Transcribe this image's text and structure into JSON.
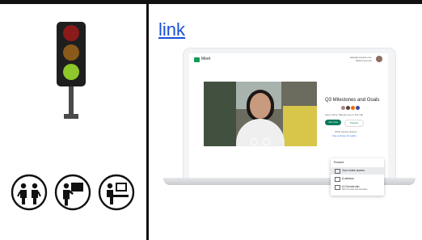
{
  "link": {
    "text": "link"
  },
  "meet": {
    "app_name": "Meet",
    "account": {
      "email": "katie@example.com",
      "switch": "Switch account"
    },
    "meeting_title": "Q3 Milestones and Goals",
    "in_call": "Lana, Chris, Maurice are in this call",
    "join_label": "Join now",
    "present_label": "Present",
    "other_options": "Other joining options",
    "phone_option": "Use a phone for audio",
    "present_menu": {
      "title": "Present",
      "items": [
        {
          "label": "Your entire screen",
          "sub": ""
        },
        {
          "label": "A window",
          "sub": ""
        },
        {
          "label": "A Chrome tab",
          "sub": "Best for video and animation"
        }
      ]
    }
  },
  "colors": {
    "light_red": "#8b1a1a",
    "light_amber": "#8a5a1a",
    "light_green": "#8ec62c",
    "accent_link": "#1a4fd6",
    "meet_green": "#0b7a5c"
  },
  "icons": [
    "traffic-light-icon",
    "people-talking-icon",
    "presenter-board-icon",
    "person-computer-icon"
  ]
}
